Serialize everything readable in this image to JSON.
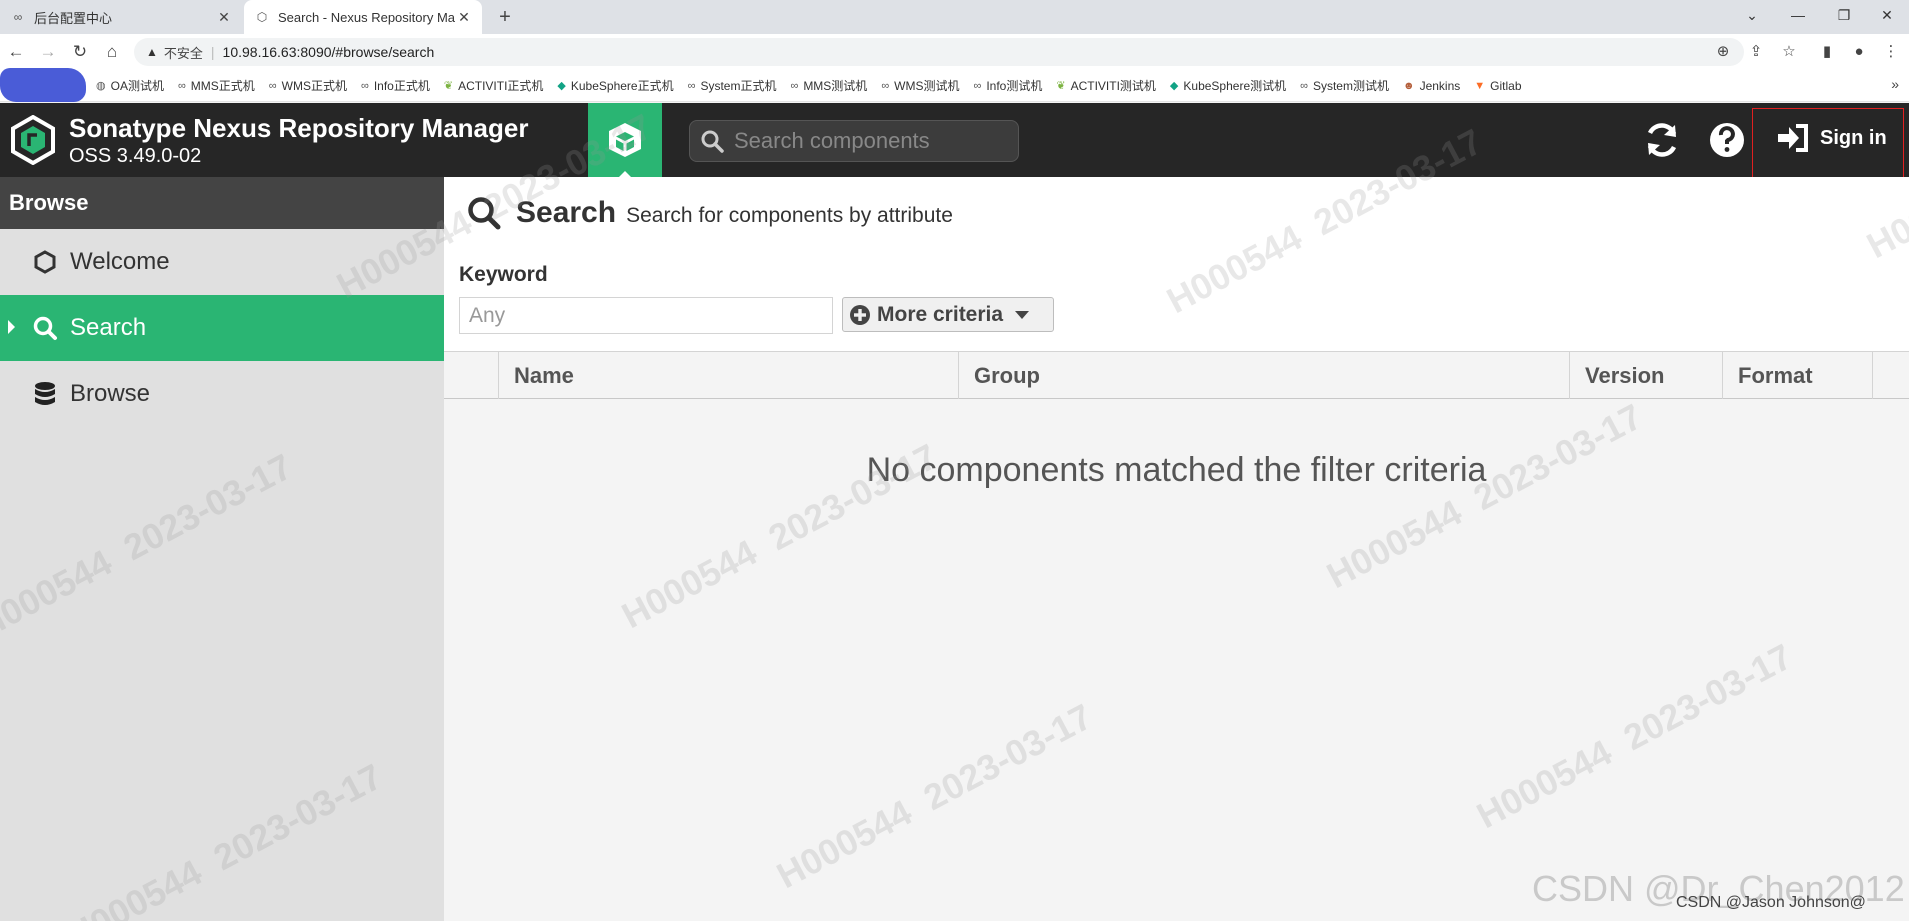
{
  "browser": {
    "tabs": [
      {
        "title": "后台配置中心",
        "icon": "infinity-icon"
      },
      {
        "title": "Search - Nexus Repository Ma",
        "icon": "nexus-hex-icon"
      }
    ],
    "insecure_label": "不安全",
    "url": "10.98.16.63:8090/#browse/search",
    "bookmarks": [
      {
        "label": "OA测试机",
        "icon": "globe"
      },
      {
        "label": "MMS正式机",
        "icon": "infinity"
      },
      {
        "label": "WMS正式机",
        "icon": "infinity"
      },
      {
        "label": "Info正式机",
        "icon": "infinity"
      },
      {
        "label": "ACTIVITI正式机",
        "icon": "leaf"
      },
      {
        "label": "KubeSphere正式机",
        "icon": "kube"
      },
      {
        "label": "System正式机",
        "icon": "infinity"
      },
      {
        "label": "MMS测试机",
        "icon": "infinity"
      },
      {
        "label": "WMS测试机",
        "icon": "infinity"
      },
      {
        "label": "Info测试机",
        "icon": "infinity"
      },
      {
        "label": "ACTIVITI测试机",
        "icon": "leaf"
      },
      {
        "label": "KubeSphere测试机",
        "icon": "kube"
      },
      {
        "label": "System测试机",
        "icon": "infinity"
      },
      {
        "label": "Jenkins",
        "icon": "jenkins"
      },
      {
        "label": "Gitlab",
        "icon": "gitlab"
      }
    ]
  },
  "header": {
    "title": "Sonatype Nexus Repository Manager",
    "version": "OSS 3.49.0-02",
    "search_placeholder": "Search components",
    "sign_in": "Sign in"
  },
  "sidebar": {
    "title": "Browse",
    "items": [
      {
        "label": "Welcome",
        "icon": "hexagon-icon",
        "active": false
      },
      {
        "label": "Search",
        "icon": "search-icon",
        "active": true
      },
      {
        "label": "Browse",
        "icon": "database-icon",
        "active": false
      }
    ]
  },
  "main": {
    "title": "Search",
    "subtitle": "Search for components by attribute",
    "keyword_label": "Keyword",
    "keyword_placeholder": "Any",
    "more_criteria": "More criteria",
    "columns": [
      "Name",
      "Group",
      "Version",
      "Format"
    ],
    "empty_message": "No components matched the filter criteria"
  },
  "watermark": {
    "id": "H000544",
    "date": "2023-03-17",
    "csdn": "CSDN @Dr_Chen2012",
    "csdn_small": "CSDN @Jason Johnson@"
  },
  "colors": {
    "accent_green": "#2ab573",
    "header_dark": "#262626",
    "sidebar_header": "#444444",
    "highlight_red": "#e02020"
  }
}
